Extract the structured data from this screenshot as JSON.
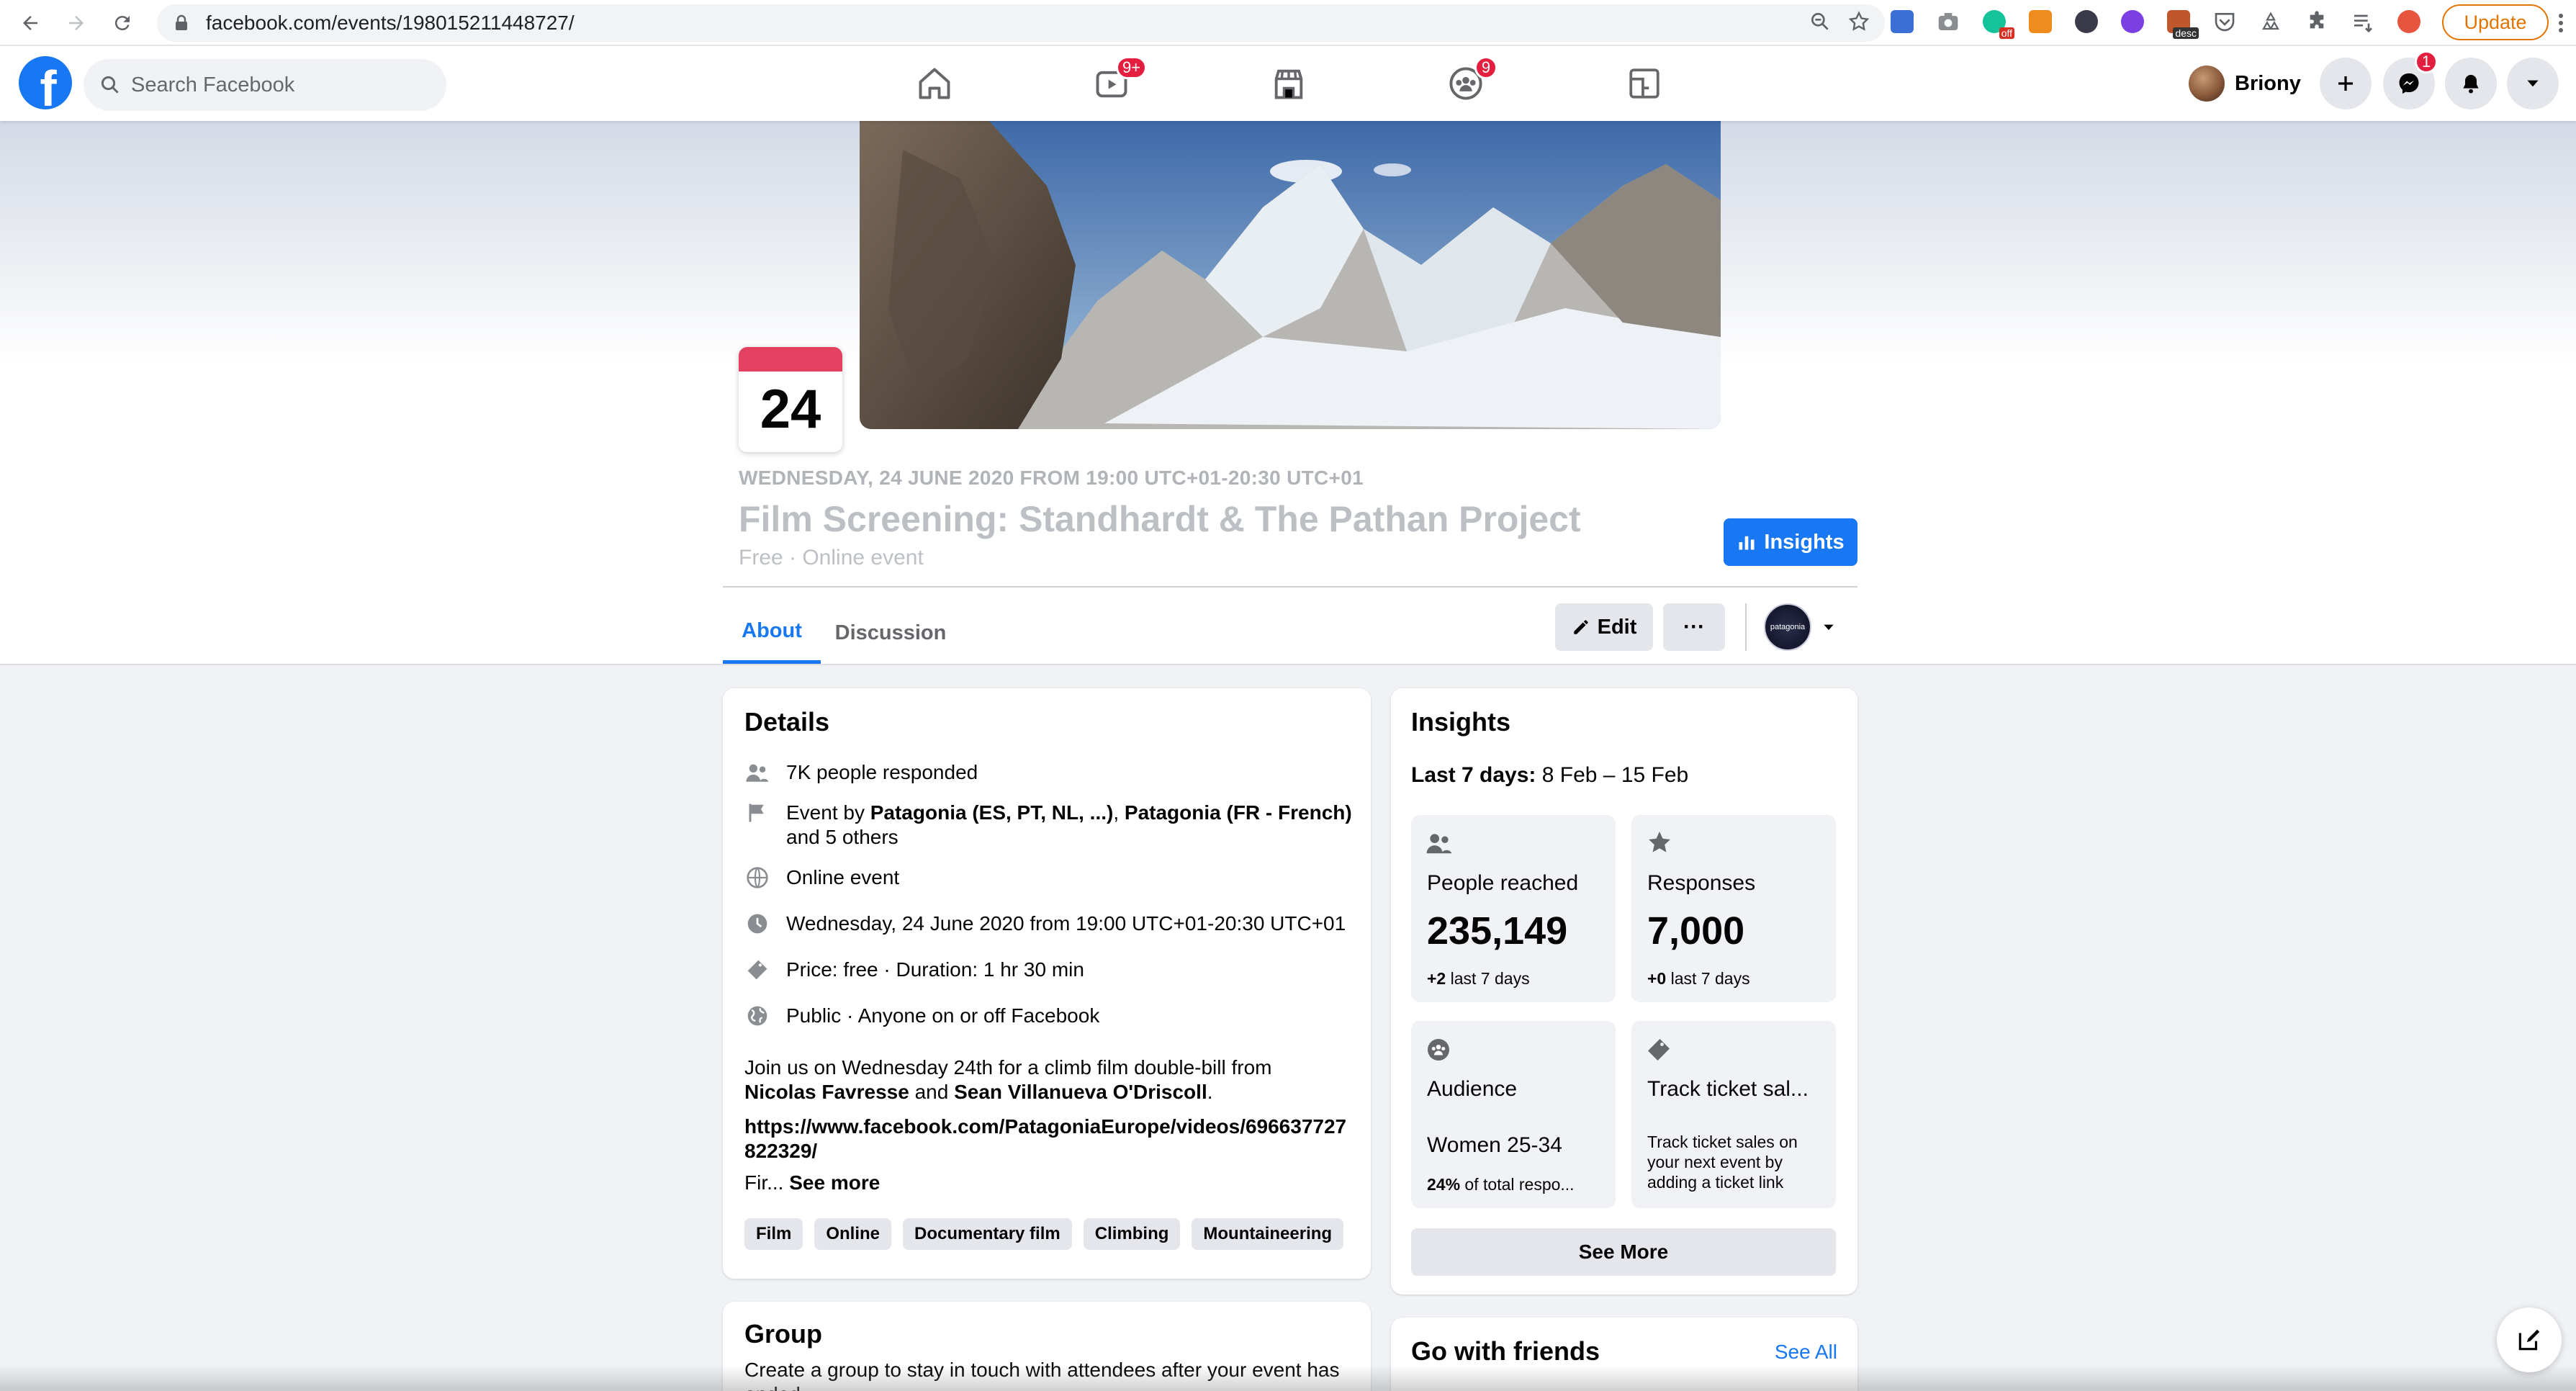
{
  "browser": {
    "url": "facebook.com/events/198015211448727/",
    "update_label": "Update",
    "extension_tags": {
      "off": "off",
      "desc": "desc"
    }
  },
  "fb": {
    "search_placeholder": "Search Facebook",
    "watch_badge": "9+",
    "groups_badge": "9",
    "user_name": "Briony",
    "messenger_badge": "1"
  },
  "event": {
    "day": "24",
    "date_line": "WEDNESDAY, 24 JUNE 2020 FROM 19:00 UTC+01-20:30 UTC+01",
    "title": "Film Screening: Standhardt & The Pathan Project",
    "subtitle": "Free · Online event",
    "insights_label": "Insights",
    "tabs": [
      {
        "label": "About"
      },
      {
        "label": "Discussion"
      }
    ],
    "edit_label": "Edit",
    "more_label": "···",
    "page_avatar_text": "patagonia"
  },
  "details": {
    "title": "Details",
    "responded": "7K people responded",
    "event_by_prefix": "Event by ",
    "host1": "Patagonia (ES, PT, NL, ...)",
    "host_sep": ", ",
    "host2": "Patagonia (FR - French)",
    "host_more": "and 5 others",
    "online": "Online event",
    "datetime": "Wednesday, 24 June 2020 from 19:00 UTC+01-20:30 UTC+01",
    "price": "Price: free · Duration: 1 hr 30 min",
    "privacy": "Public · Anyone on or off Facebook",
    "desc_line1": "Join us on Wednesday 24th for a climb film double-bill from",
    "desc_name1": "Nicolas Favresse",
    "desc_and": " and ",
    "desc_name2": "Sean Villanueva O'Driscoll",
    "desc_dot": ".",
    "link_line1": "https://www.facebook.com/PatagoniaEurope/videos/696637727",
    "link_line2": "822329/",
    "truncated": "Fir... ",
    "see_more": "See more",
    "tags": [
      "Film",
      "Online",
      "Documentary film",
      "Climbing",
      "Mountaineering"
    ]
  },
  "insights": {
    "title": "Insights",
    "period_label": "Last 7 days:",
    "period_range": " 8 Feb – 15 Feb",
    "people_reached_label": "People reached",
    "people_reached_value": "235,149",
    "people_reached_delta": "+2",
    "delta_suffix": " last 7 days",
    "responses_label": "Responses",
    "responses_value": "7,000",
    "responses_delta": "+0",
    "audience_label": "Audience",
    "audience_value": "Women 25-34",
    "audience_pct": "24%",
    "audience_pct_suffix": " of total respo...",
    "ticket_label": "Track ticket sal...",
    "ticket_desc": "Track ticket sales on your next event by adding a ticket link",
    "see_more_label": "See More"
  },
  "group": {
    "title": "Group",
    "desc": "Create a group to stay in touch with attendees after your event has ended."
  },
  "friends": {
    "title": "Go with friends",
    "see_all": "See All"
  },
  "colors": {
    "fb_blue": "#1877f2",
    "badge_red": "#e41e3f",
    "update_orange": "#e37400"
  }
}
